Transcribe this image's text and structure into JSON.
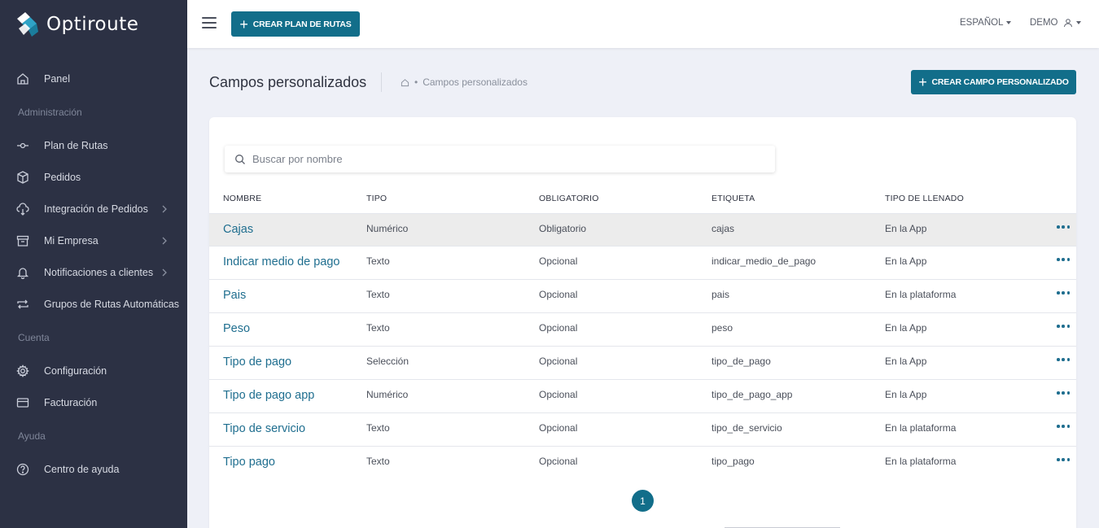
{
  "app": {
    "name": "Optiroute"
  },
  "sidebar": {
    "items": [
      {
        "key": "panel",
        "label": "Panel",
        "icon": "home-icon"
      },
      {
        "section": "Administración"
      },
      {
        "key": "plan",
        "label": "Plan de Rutas",
        "icon": "route-icon"
      },
      {
        "key": "pedidos",
        "label": "Pedidos",
        "icon": "box-icon"
      },
      {
        "key": "integracion",
        "label": "Integración de Pedidos",
        "icon": "cloud-download-icon",
        "chevron": true
      },
      {
        "key": "empresa",
        "label": "Mi Empresa",
        "icon": "archive-icon",
        "chevron": true
      },
      {
        "key": "notificaciones",
        "label": "Notificaciones a clientes",
        "icon": "bell-icon",
        "chevron": true
      },
      {
        "key": "grupos",
        "label": "Grupos de Rutas Automáticas",
        "icon": "repeat-icon"
      },
      {
        "section": "Cuenta"
      },
      {
        "key": "config",
        "label": "Configuración",
        "icon": "gear-icon"
      },
      {
        "key": "facturacion",
        "label": "Facturación",
        "icon": "credit-card-icon"
      },
      {
        "section": "Ayuda"
      },
      {
        "key": "ayuda",
        "label": "Centro de ayuda",
        "icon": "help-icon"
      }
    ]
  },
  "topbar": {
    "create_plan_label": "CREAR PLAN DE RUTAS",
    "language": "ESPAÑOL",
    "user": "DEMO"
  },
  "page": {
    "title": "Campos personalizados",
    "breadcrumb_current": "Campos personalizados",
    "create_field_label": "CREAR CAMPO PERSONALIZADO"
  },
  "search": {
    "placeholder": "Buscar por nombre"
  },
  "table": {
    "headers": [
      "NOMBRE",
      "TIPO",
      "OBLIGATORIO",
      "ETIQUETA",
      "TIPO DE LLENADO"
    ],
    "rows": [
      {
        "nombre": "Cajas",
        "tipo": "Numérico",
        "obligatorio": "Obligatorio",
        "etiqueta": "cajas",
        "llenado": "En la App"
      },
      {
        "nombre": "Indicar medio de pago",
        "tipo": "Texto",
        "obligatorio": "Opcional",
        "etiqueta": "indicar_medio_de_pago",
        "llenado": "En la App"
      },
      {
        "nombre": "Pais",
        "tipo": "Texto",
        "obligatorio": "Opcional",
        "etiqueta": "pais",
        "llenado": "En la plataforma"
      },
      {
        "nombre": "Peso",
        "tipo": "Texto",
        "obligatorio": "Opcional",
        "etiqueta": "peso",
        "llenado": "En la App"
      },
      {
        "nombre": "Tipo de pago",
        "tipo": "Selección",
        "obligatorio": "Opcional",
        "etiqueta": "tipo_de_pago",
        "llenado": "En la App"
      },
      {
        "nombre": "Tipo de pago app",
        "tipo": "Numérico",
        "obligatorio": "Opcional",
        "etiqueta": "tipo_de_pago_app",
        "llenado": "En la App"
      },
      {
        "nombre": "Tipo de servicio",
        "tipo": "Texto",
        "obligatorio": "Opcional",
        "etiqueta": "tipo_de_servicio",
        "llenado": "En la plataforma"
      },
      {
        "nombre": "Tipo pago",
        "tipo": "Texto",
        "obligatorio": "Opcional",
        "etiqueta": "tipo_pago",
        "llenado": "En la plataforma"
      }
    ]
  },
  "pagination": {
    "current": "1"
  },
  "colors": {
    "accent": "#126e8a",
    "sidebar": "#2c3144",
    "link": "#1f6e8f"
  }
}
